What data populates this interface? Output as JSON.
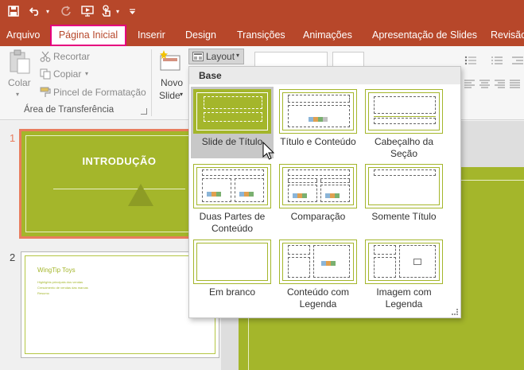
{
  "titlebar": {
    "qat_icons": [
      "save-icon",
      "undo-icon",
      "redo-icon",
      "present-from-beginning-icon",
      "touch-mode-icon",
      "customize-qat-icon"
    ]
  },
  "tabs": [
    {
      "id": "arquivo",
      "label": "Arquivo",
      "active": false
    },
    {
      "id": "pagina-inicial",
      "label": "Página Inicial",
      "active": true
    },
    {
      "id": "inserir",
      "label": "Inserir",
      "active": false
    },
    {
      "id": "design",
      "label": "Design",
      "active": false
    },
    {
      "id": "transicoes",
      "label": "Transições",
      "active": false
    },
    {
      "id": "animacoes",
      "label": "Animações",
      "active": false
    },
    {
      "id": "apresentacao",
      "label": "Apresentação de Slides",
      "active": false
    },
    {
      "id": "revisao",
      "label": "Revisão",
      "active": false
    }
  ],
  "ribbon": {
    "colar": "Colar",
    "recortar": "Recortar",
    "copiar": "Copiar",
    "pincel": "Pincel de Formatação",
    "clipboard_group": "Área de Transferência",
    "novo": "Novo",
    "slide": "Slide",
    "layout": "Layout"
  },
  "gallery": {
    "header": "Base",
    "layouts": [
      {
        "name": "Slide de Título",
        "selected": true
      },
      {
        "name": "Título e Conteúdo",
        "selected": false
      },
      {
        "name": "Cabeçalho da Seção",
        "selected": false
      },
      {
        "name": "Duas Partes de Conteúdo",
        "selected": false
      },
      {
        "name": "Comparação",
        "selected": false
      },
      {
        "name": "Somente Título",
        "selected": false
      },
      {
        "name": "Em branco",
        "selected": false
      },
      {
        "name": "Conteúdo com Legenda",
        "selected": false
      },
      {
        "name": "Imagem com Legenda",
        "selected": false
      }
    ]
  },
  "slides": [
    {
      "number": "1",
      "title": "INTRODUÇÃO"
    },
    {
      "number": "2",
      "title": "WingTip Toys",
      "bullets": [
        "Highlights principais dos vendas",
        "Crescimento de vendas das marcas",
        "Resumo"
      ]
    }
  ],
  "colors": {
    "accent": "#b7472a",
    "highlight": "#e6007e",
    "theme_green": "#a4b62b",
    "selected_outline": "#e87c5e"
  }
}
